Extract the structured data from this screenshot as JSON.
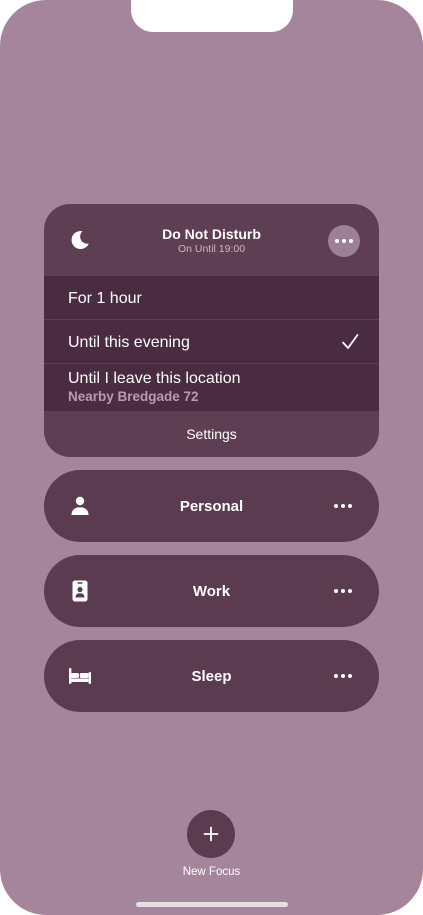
{
  "colors": {
    "background": "#a5859b",
    "card": "#5e3e52",
    "options_panel": "#4a2c42",
    "focus_row": "#5b3b4f",
    "more_button": "#9c8095",
    "subtitle_text": "#c9b7c3",
    "option_subtext": "#b99aae"
  },
  "dnd": {
    "icon": "moon-icon",
    "title": "Do Not Disturb",
    "subtitle": "On Until 19:00",
    "options": [
      {
        "label": "For 1 hour",
        "selected": false
      },
      {
        "label": "Until this evening",
        "selected": true
      },
      {
        "label": "Until I leave this location",
        "sublabel": "Nearby Bredgade 72",
        "selected": false
      }
    ],
    "settings_label": "Settings"
  },
  "focus_modes": [
    {
      "label": "Personal",
      "icon": "person-icon"
    },
    {
      "label": "Work",
      "icon": "id-badge-icon"
    },
    {
      "label": "Sleep",
      "icon": "bed-icon"
    }
  ],
  "new_focus": {
    "icon": "plus-icon",
    "label": "New Focus"
  }
}
